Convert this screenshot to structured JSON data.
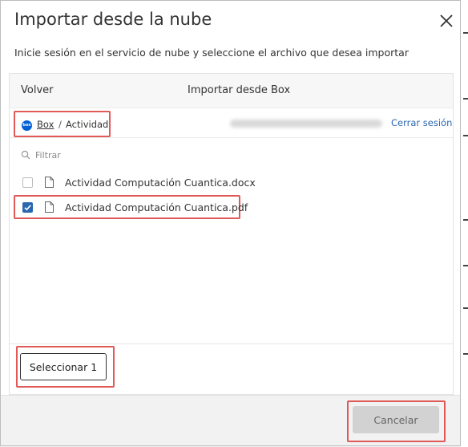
{
  "dialog": {
    "title": "Importar desde la nube",
    "subtitle": "Inicie sesión en el servicio de nube y seleccione el archivo que desea importar"
  },
  "panel": {
    "back_label": "Volver",
    "title": "Importar desde Box",
    "breadcrumb": {
      "root": "Box",
      "separator": "/",
      "current": "Actividad"
    },
    "logout_label": "Cerrar sesión",
    "filter_placeholder": "Filtrar",
    "files": [
      {
        "name": "Actividad Computación Cuantica.docx",
        "checked": false
      },
      {
        "name": "Actividad Computación Cuantica.pdf",
        "checked": true
      }
    ],
    "select_label": "Seleccionar 1"
  },
  "footer": {
    "cancel_label": "Cancelar"
  },
  "icons": {
    "close": "close-icon",
    "search": "search-icon",
    "file": "file-icon",
    "box_logo": "box-logo-icon",
    "check": "check-icon"
  },
  "colors": {
    "accent": "#2b66b0",
    "highlight": "#e05a5a",
    "box_brand": "#0061d5"
  }
}
